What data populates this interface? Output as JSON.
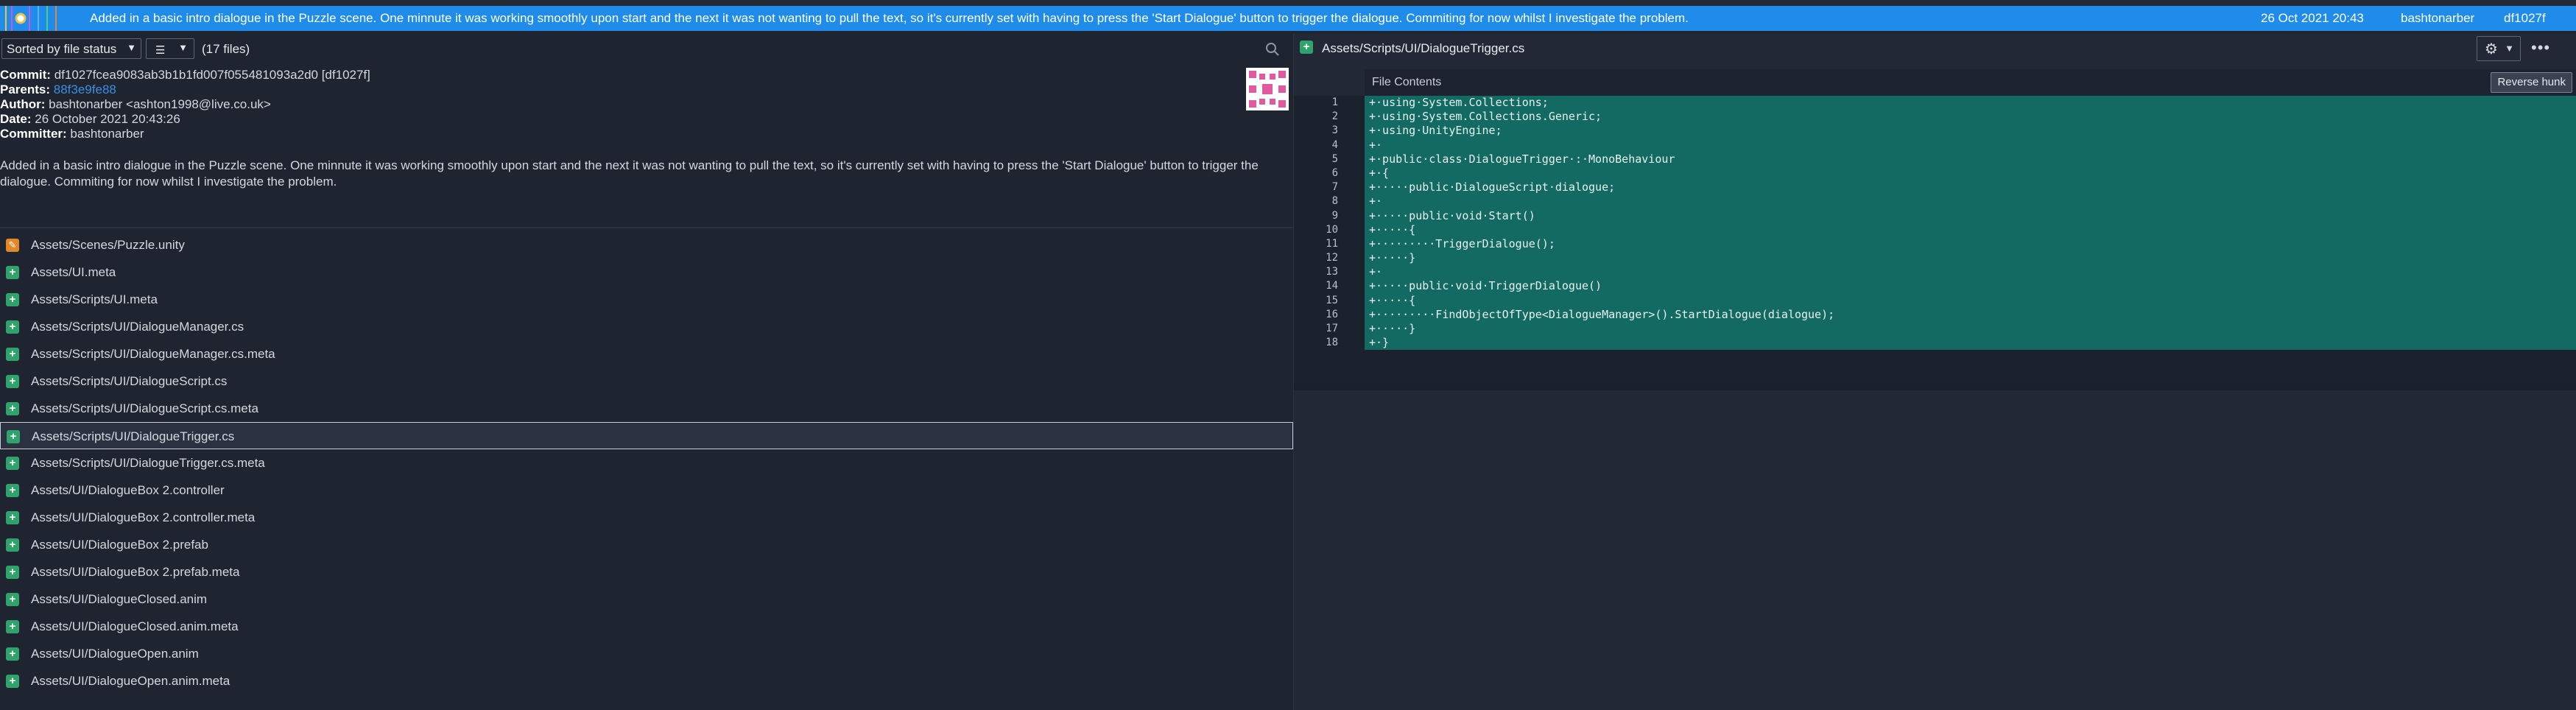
{
  "commit_row": {
    "message": "Added in a basic intro dialogue in the Puzzle scene. One minnute it was working smoothly upon start and the next it was not wanting to pull the text, so it's currently set with having to press the 'Start Dialogue' button to trigger the dialogue. Commiting for now whilst I investigate the problem.",
    "date": "26 Oct 2021 20:43",
    "author": "bashtonarber",
    "sha": "df1027f",
    "color": "#1f8ceb"
  },
  "toolbar": {
    "sort_label": "Sorted by file status",
    "file_count": "(17 files)"
  },
  "commit_meta": {
    "commit_label": "Commit:",
    "commit_value": "df1027fcea9083ab3b1b1fd007f055481093a2d0 [df1027f]",
    "parents_label": "Parents:",
    "parents_value": "88f3e9fe88",
    "author_label": "Author:",
    "author_value": "bashtonarber <ashton1998@live.co.uk>",
    "date_label": "Date:",
    "date_value": "26 October 2021 20:43:26",
    "committer_label": "Committer:",
    "committer_value": "bashtonarber"
  },
  "description": "Added in a basic intro dialogue in the Puzzle scene. One minnute it was working smoothly upon start and the next it was not wanting to pull the text, so it's currently set with having to press the 'Start Dialogue' button to trigger the dialogue. Commiting for now whilst I investigate the problem.",
  "files": [
    {
      "name": "Assets/Scenes/Puzzle.unity",
      "status": "modified"
    },
    {
      "name": "Assets/UI.meta",
      "status": "added"
    },
    {
      "name": "Assets/Scripts/UI.meta",
      "status": "added"
    },
    {
      "name": "Assets/Scripts/UI/DialogueManager.cs",
      "status": "added"
    },
    {
      "name": "Assets/Scripts/UI/DialogueManager.cs.meta",
      "status": "added"
    },
    {
      "name": "Assets/Scripts/UI/DialogueScript.cs",
      "status": "added"
    },
    {
      "name": "Assets/Scripts/UI/DialogueScript.cs.meta",
      "status": "added"
    },
    {
      "name": "Assets/Scripts/UI/DialogueTrigger.cs",
      "status": "added",
      "selected": true
    },
    {
      "name": "Assets/Scripts/UI/DialogueTrigger.cs.meta",
      "status": "added"
    },
    {
      "name": "Assets/UI/DialogueBox 2.controller",
      "status": "added"
    },
    {
      "name": "Assets/UI/DialogueBox 2.controller.meta",
      "status": "added"
    },
    {
      "name": "Assets/UI/DialogueBox 2.prefab",
      "status": "added"
    },
    {
      "name": "Assets/UI/DialogueBox 2.prefab.meta",
      "status": "added"
    },
    {
      "name": "Assets/UI/DialogueClosed.anim",
      "status": "added"
    },
    {
      "name": "Assets/UI/DialogueClosed.anim.meta",
      "status": "added"
    },
    {
      "name": "Assets/UI/DialogueOpen.anim",
      "status": "added"
    },
    {
      "name": "Assets/UI/DialogueOpen.anim.meta",
      "status": "added"
    }
  ],
  "viewer": {
    "path": "Assets/Scripts/UI/DialogueTrigger.cs",
    "contents_label": "File Contents",
    "reverse_hunk_label": "Reverse hunk",
    "added_color": "#126a63",
    "lines": [
      {
        "n": "1",
        "text": "+·using·System.Collections;"
      },
      {
        "n": "2",
        "text": "+·using·System.Collections.Generic;"
      },
      {
        "n": "3",
        "text": "+·using·UnityEngine;"
      },
      {
        "n": "4",
        "text": "+·"
      },
      {
        "n": "5",
        "text": "+·public·class·DialogueTrigger·:·MonoBehaviour"
      },
      {
        "n": "6",
        "text": "+·{"
      },
      {
        "n": "7",
        "text": "+·····public·DialogueScript·dialogue;"
      },
      {
        "n": "8",
        "text": "+·"
      },
      {
        "n": "9",
        "text": "+·····public·void·Start()"
      },
      {
        "n": "10",
        "text": "+·····{"
      },
      {
        "n": "11",
        "text": "+·········TriggerDialogue();"
      },
      {
        "n": "12",
        "text": "+·····}"
      },
      {
        "n": "13",
        "text": "+·"
      },
      {
        "n": "14",
        "text": "+·····public·void·TriggerDialogue()"
      },
      {
        "n": "15",
        "text": "+·····{"
      },
      {
        "n": "16",
        "text": "+·········FindObjectOfType<DialogueManager>().StartDialogue(dialogue);"
      },
      {
        "n": "17",
        "text": "+·····}"
      },
      {
        "n": "18",
        "text": "+·}"
      }
    ]
  }
}
